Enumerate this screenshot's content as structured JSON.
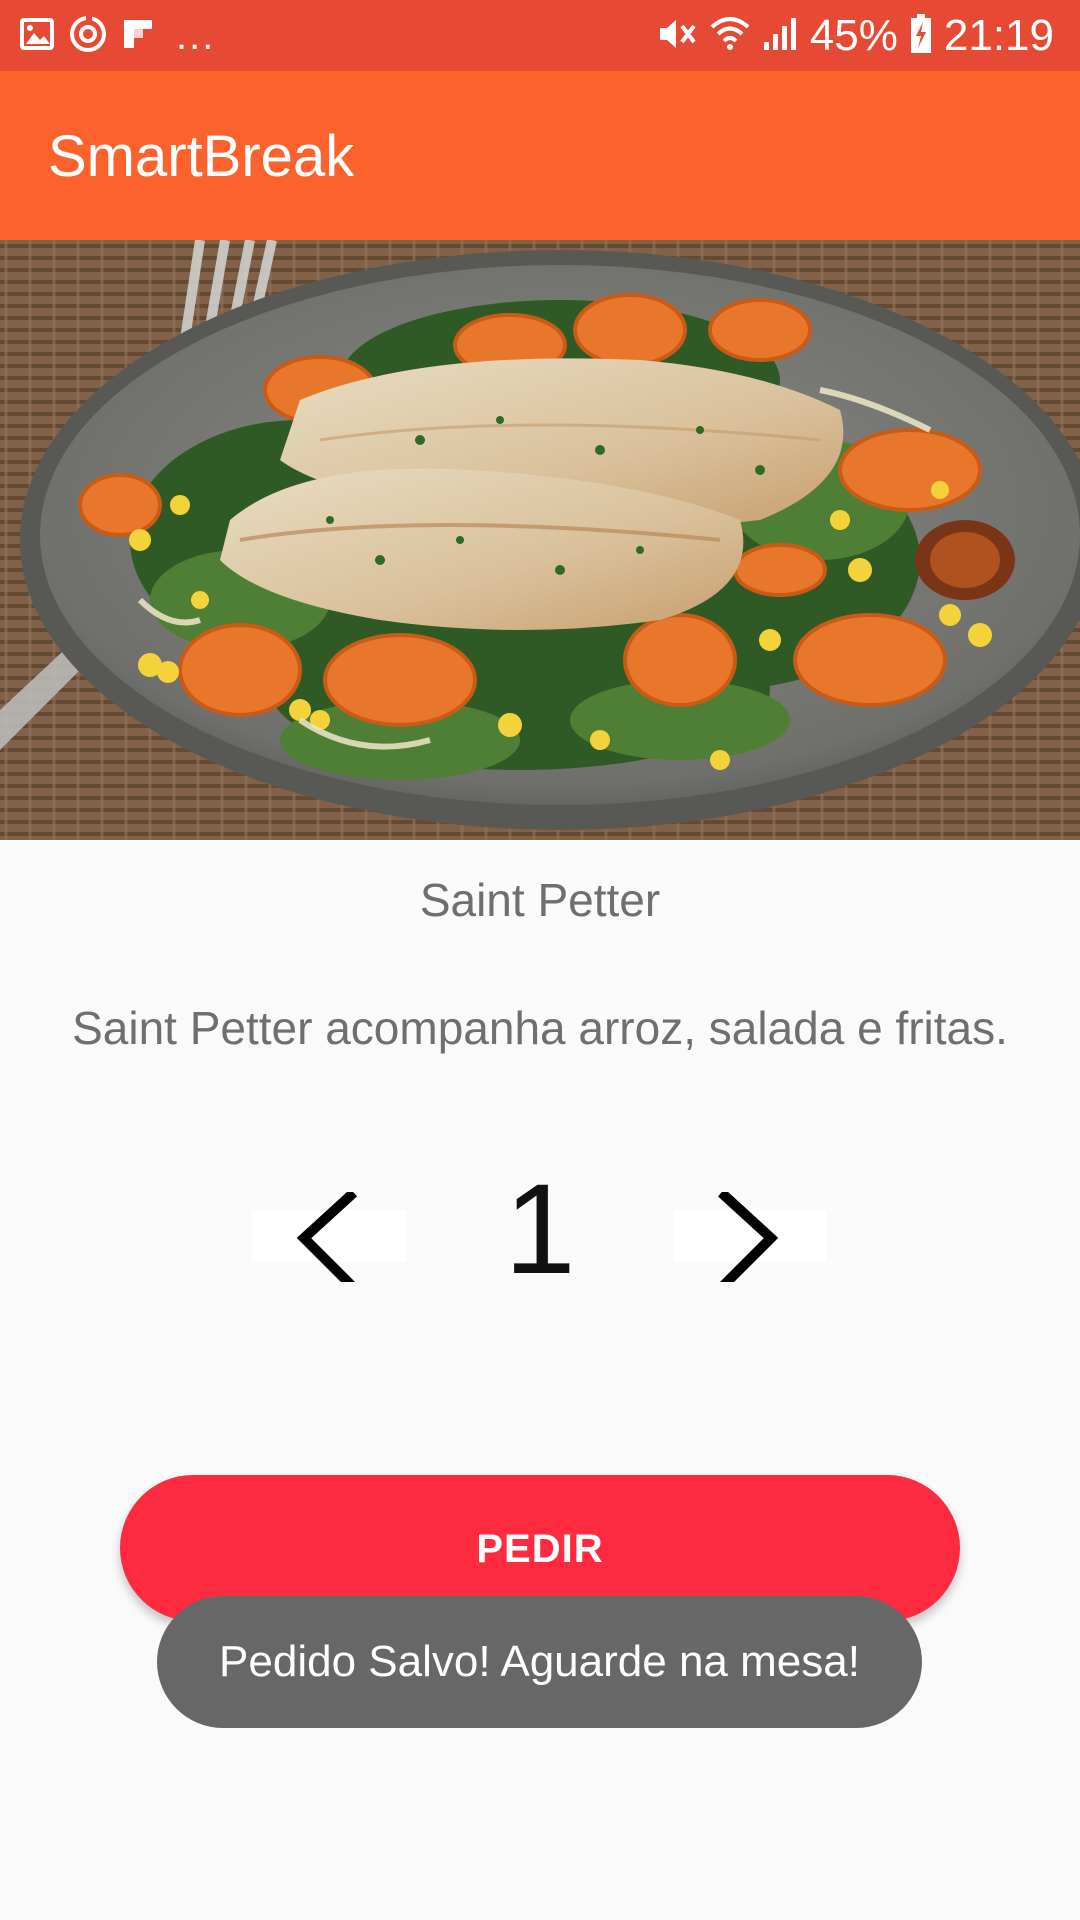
{
  "status_bar": {
    "notification_icons": [
      "image-icon",
      "sync-circle-icon",
      "flipboard-icon"
    ],
    "more_indicator": "...",
    "system_icons": [
      "mute-icon",
      "wifi-icon",
      "signal-icon",
      "battery-charging-icon"
    ],
    "battery": "45%",
    "time": "21:19",
    "background_color": "#e64a34"
  },
  "app_bar": {
    "title": "SmartBreak",
    "background_color": "#fb622c"
  },
  "dish": {
    "image_icon": "fish-plate-photo",
    "name": "Saint Petter",
    "description": "Saint Petter acompanha arroz, salada e fritas."
  },
  "stepper": {
    "prev_icon": "chevron-left-icon",
    "next_icon": "chevron-right-icon",
    "quantity": "1"
  },
  "order_button": {
    "label": "PEDIR",
    "color": "#fe2b40"
  },
  "toast": {
    "message": "Pedido Salvo! Aguarde na mesa!"
  }
}
